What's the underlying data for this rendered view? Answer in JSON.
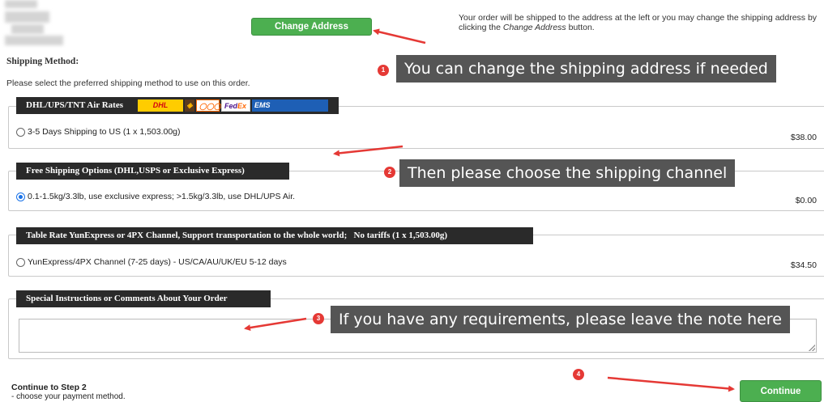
{
  "address": {
    "change_button": "Change Address",
    "shipping_note_prefix": "Your order will be shipped to the address at the left or you may change the shipping address by clicking the ",
    "shipping_note_link": "Change Address",
    "shipping_note_suffix": " button."
  },
  "shipping": {
    "title": "Shipping Method:",
    "description": "Please select the preferred shipping method to use on this order.",
    "groups": [
      {
        "legend": "DHL/UPS/TNT Air Rates",
        "logos": [
          "DHL",
          "UPS",
          "TNT",
          "FedEx",
          "EMS"
        ],
        "option": "3-5 Days Shipping to US (1 x 1,503.00g)",
        "price": "$38.00",
        "selected": false
      },
      {
        "legend": "Free Shipping Options (DHL,USPS or Exclusive Express)",
        "option": "0.1-1.5kg/3.3lb, use exclusive express; >1.5kg/3.3lb, use DHL/UPS Air.",
        "price": "$0.00",
        "selected": true
      },
      {
        "legend": "Table Rate YunExpress or 4PX Channel, Support transportation to the whole world;   No tariffs (1 x 1,503.00g)",
        "option": "YunExpress/4PX Channel (7-25 days) - US/CA/AU/UK/EU 5-12 days",
        "price": "$34.50",
        "selected": false
      }
    ]
  },
  "comments": {
    "legend": "Special Instructions or Comments About Your Order",
    "value": ""
  },
  "step": {
    "title": "Continue to Step 2",
    "description": "- choose your payment method.",
    "continue_button": "Continue"
  },
  "annotations": [
    {
      "number": "1",
      "text": "You can change the shipping address if needed"
    },
    {
      "number": "2",
      "text": "Then please choose the shipping channel"
    },
    {
      "number": "3",
      "text": "If you have any requirements, please leave the note here"
    },
    {
      "number": "4",
      "text": ""
    }
  ],
  "colors": {
    "accent_green": "#4caf50",
    "legend_bg": "#2a2a2a",
    "callout_bg": "#555555",
    "annotation_red": "#e53935"
  }
}
